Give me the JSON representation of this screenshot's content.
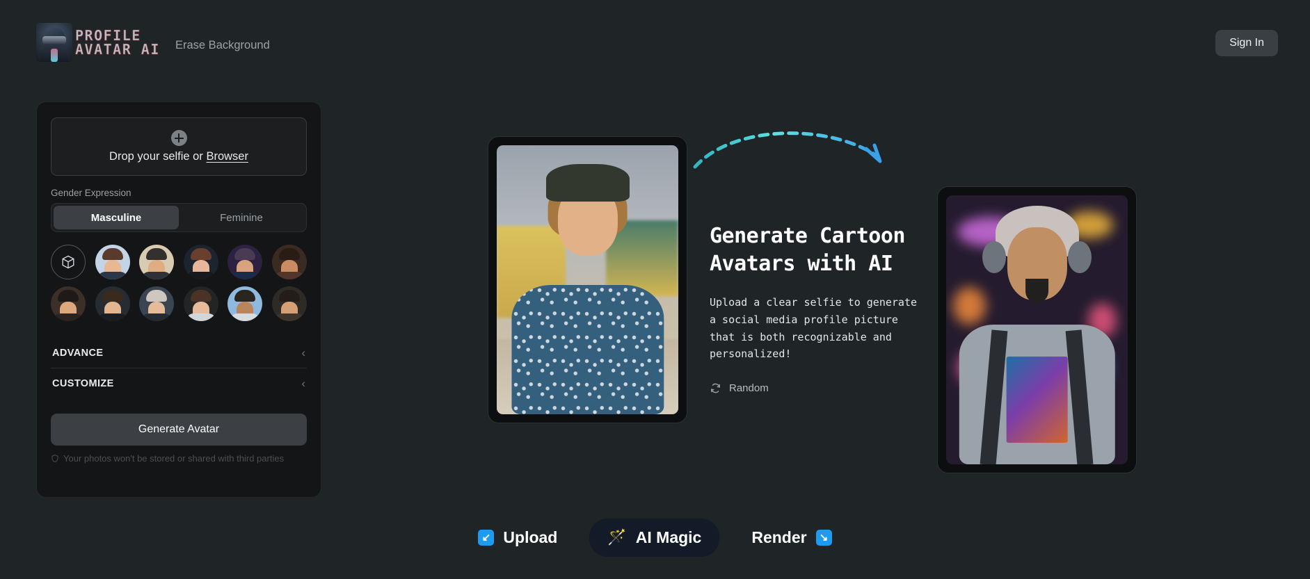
{
  "header": {
    "logo_line1": "PROFILE",
    "logo_line2": "AVATAR AI",
    "nav_link": "Erase Background",
    "signin_label": "Sign In"
  },
  "panel": {
    "dropzone_text": "Drop your selfie or ",
    "dropzone_link": "Browser",
    "gender_label": "Gender Expression",
    "gender_options": [
      {
        "label": "Masculine",
        "active": true
      },
      {
        "label": "Feminine",
        "active": false
      }
    ],
    "avatar_presets": [
      {
        "name": "randomize-dice",
        "icon": "dice-icon"
      },
      {
        "name": "preset-1",
        "bg": "#c3d4e6",
        "hair": "#5a3a2a",
        "skin": "#e8b894",
        "torso": "#2b3748"
      },
      {
        "name": "preset-2",
        "bg": "#d9cbb2",
        "hair": "#33302d",
        "skin": "#e0ac84",
        "torso": "#2d3036"
      },
      {
        "name": "preset-3",
        "bg": "#1c2430",
        "hair": "#6b3f2e",
        "skin": "#e6b79a",
        "torso": "#17191d"
      },
      {
        "name": "preset-4",
        "bg": "#2c2140",
        "hair": "#4a3b52",
        "skin": "#d9a37f",
        "torso": "#1b2a4a"
      },
      {
        "name": "preset-5",
        "bg": "#3a2a22",
        "hair": "#2a1c14",
        "skin": "#c98c63",
        "torso": "#50372a"
      },
      {
        "name": "preset-6",
        "bg": "#3c2f27",
        "hair": "#1f1a17",
        "skin": "#dca87c",
        "torso": "#2a2320"
      },
      {
        "name": "preset-7",
        "bg": "#272c33",
        "hair": "#3a2a1e",
        "skin": "#e3b68f",
        "torso": "#1a1d22"
      },
      {
        "name": "preset-8",
        "bg": "#3a4551",
        "hair": "#cfc6bd",
        "skin": "#e6bb98",
        "torso": "#262b31"
      },
      {
        "name": "preset-9",
        "bg": "#232424",
        "hair": "#4a3226",
        "skin": "#e7bb9a",
        "torso": "#cfd6dc"
      },
      {
        "name": "preset-10",
        "bg": "#8fb9dd",
        "hair": "#2b2520",
        "skin": "#b9855c",
        "torso": "#d5dbe0"
      },
      {
        "name": "preset-11",
        "bg": "#2e2a26",
        "hair": "#241c16",
        "skin": "#d6a075",
        "torso": "#3d342c"
      }
    ],
    "sections": [
      {
        "title": "ADVANCE",
        "chevron": "chevron-left-icon"
      },
      {
        "title": "CUSTOMIZE",
        "chevron": "chevron-left-icon"
      }
    ],
    "generate_label": "Generate Avatar",
    "privacy_note": "Your photos won't be stored or shared with third parties"
  },
  "stage": {
    "headline": "Generate Cartoon Avatars with AI",
    "subcopy": "Upload a clear selfie to generate a social media profile picture that is both recognizable and personalized!",
    "random_label": "Random",
    "random_icon": "refresh-icon",
    "arrow_color_start": "#3fd8d8",
    "arrow_color_end": "#3aa0e8",
    "source_photo_alt": "source-selfie-photo",
    "result_photo_alt": "generated-cartoon-avatar"
  },
  "bottombar": {
    "items": [
      {
        "label": "Upload",
        "icon": "arrow-down-left-icon",
        "icon_side": "left",
        "glyph": "↙",
        "active": false
      },
      {
        "label": "AI Magic",
        "icon": "magic-wand-icon",
        "icon_side": "left",
        "glyph": "🪄",
        "active": true
      },
      {
        "label": "Render",
        "icon": "arrow-down-right-icon",
        "icon_side": "right",
        "glyph": "↘",
        "active": false
      }
    ]
  },
  "colors": {
    "background": "#1f2427",
    "panel": "#141516",
    "accent_blue": "#1d9bf0",
    "active_pill": "#141b28"
  }
}
